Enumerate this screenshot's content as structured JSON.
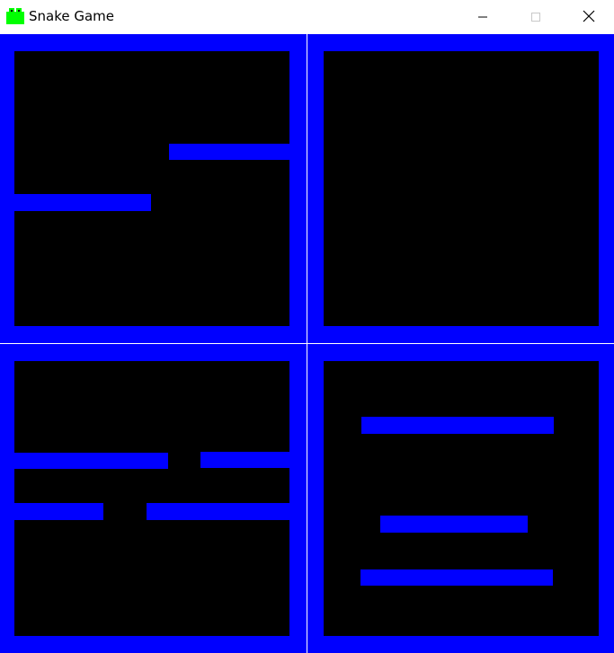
{
  "window": {
    "title": "Snake Game"
  },
  "titlebar_icons": {
    "app": "snake-icon",
    "minimize": "minimize-icon",
    "maximize": "maximize-icon",
    "close": "close-icon"
  },
  "colors": {
    "wall": "#0000ff",
    "floor": "#000000",
    "divider": "#ffffff",
    "app_icon": "#00ff00"
  },
  "game": {
    "levels": [
      {
        "id": "level-1"
      },
      {
        "id": "level-2"
      },
      {
        "id": "level-3"
      },
      {
        "id": "level-4"
      }
    ]
  }
}
